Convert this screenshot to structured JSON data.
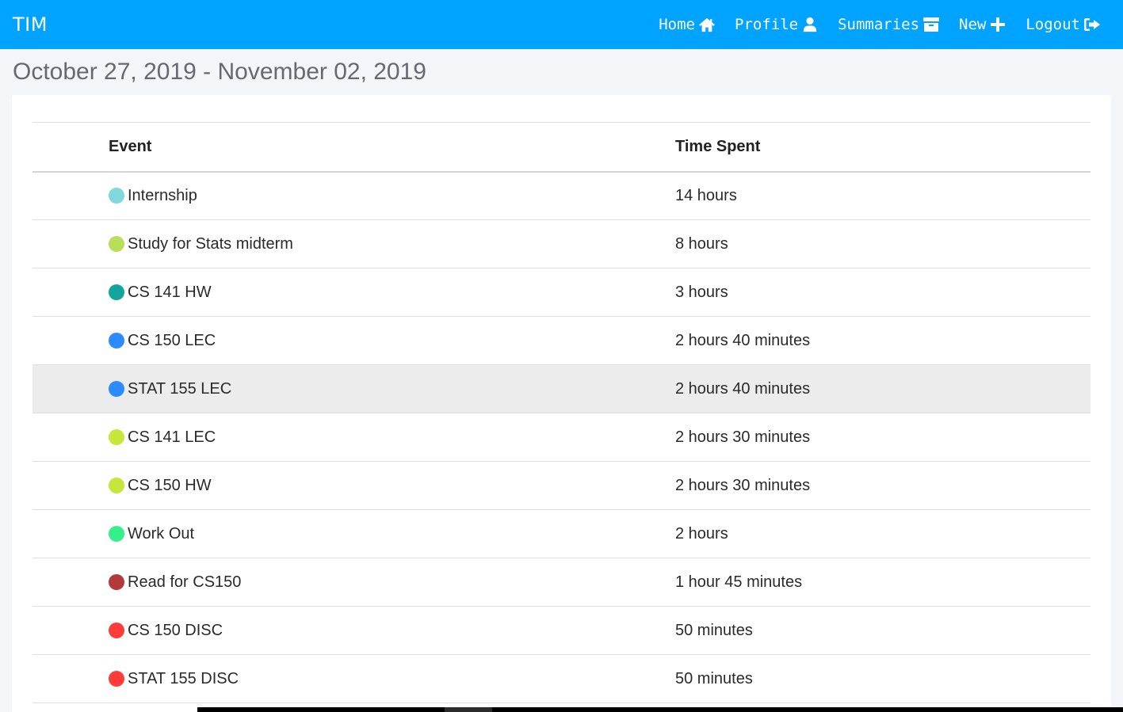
{
  "navbar": {
    "brand": "TIM",
    "items": [
      {
        "label": "Home",
        "icon": "home-icon"
      },
      {
        "label": "Profile",
        "icon": "user-icon"
      },
      {
        "label": "Summaries",
        "icon": "archive-icon"
      },
      {
        "label": "New",
        "icon": "plus-icon"
      },
      {
        "label": "Logout",
        "icon": "sign-out-icon"
      }
    ],
    "bg_color": "#00a3ff"
  },
  "page": {
    "title": "October 27, 2019 - November 02, 2019"
  },
  "table": {
    "headers": [
      "Event",
      "Time Spent"
    ],
    "rows": [
      {
        "event": "Internship",
        "time": "14 hours",
        "color": "#7fd8dc"
      },
      {
        "event": "Study for Stats midterm",
        "time": "8 hours",
        "color": "#b9de5a"
      },
      {
        "event": "CS 141 HW",
        "time": "3 hours",
        "color": "#12a59c"
      },
      {
        "event": "CS 150 LEC",
        "time": "2 hours 40 minutes",
        "color": "#2c8cff"
      },
      {
        "event": "STAT 155 LEC",
        "time": "2 hours 40 minutes",
        "color": "#2c8cff"
      },
      {
        "event": "CS 141 LEC",
        "time": "2 hours 30 minutes",
        "color": "#c6e63a"
      },
      {
        "event": "CS 150 HW",
        "time": "2 hours 30 minutes",
        "color": "#c6e63a"
      },
      {
        "event": "Work Out",
        "time": "2 hours",
        "color": "#35f08a"
      },
      {
        "event": "Read for CS150",
        "time": "1 hour 45 minutes",
        "color": "#b3393a"
      },
      {
        "event": "CS 150 DISC",
        "time": "50 minutes",
        "color": "#ff3b3b"
      },
      {
        "event": "STAT 155 DISC",
        "time": "50 minutes",
        "color": "#ff3b3b"
      }
    ]
  }
}
